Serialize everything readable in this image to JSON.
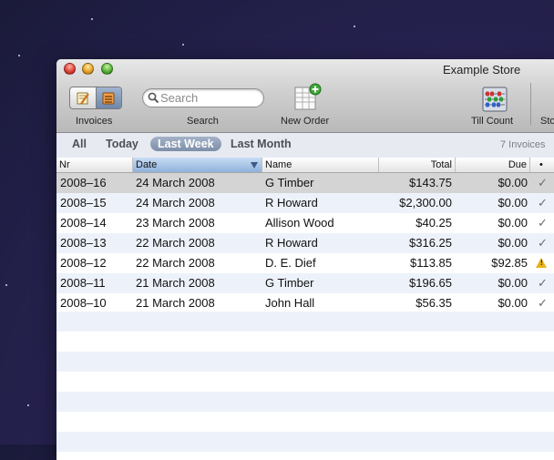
{
  "window": {
    "title": "Example Store"
  },
  "toolbar": {
    "invoices_label": "Invoices",
    "search_label": "Search",
    "search_placeholder": "Search",
    "new_order_label": "New Order",
    "till_count_label": "Till Count",
    "store_label": "Sto"
  },
  "filters": {
    "items": [
      "All",
      "Today",
      "Last Week",
      "Last Month"
    ],
    "active": "Last Week",
    "count_text": "7 Invoices"
  },
  "table": {
    "headers": {
      "nr": "Nr",
      "date": "Date",
      "name": "Name",
      "total": "Total",
      "due": "Due",
      "status": "•"
    },
    "sorted_column": "Date",
    "rows": [
      {
        "nr": "2008–16",
        "date": "24 March 2008",
        "name": "G Timber",
        "total": "$143.75",
        "due": "$0.00",
        "status": "paid",
        "status_glyph": "✓"
      },
      {
        "nr": "2008–15",
        "date": "24 March 2008",
        "name": "R Howard",
        "total": "$2,300.00",
        "due": "$0.00",
        "status": "paid",
        "status_glyph": "✓"
      },
      {
        "nr": "2008–14",
        "date": "23 March 2008",
        "name": "Allison Wood",
        "total": "$40.25",
        "due": "$0.00",
        "status": "paid",
        "status_glyph": "✓"
      },
      {
        "nr": "2008–13",
        "date": "22 March 2008",
        "name": "R Howard",
        "total": "$316.25",
        "due": "$0.00",
        "status": "paid",
        "status_glyph": "✓"
      },
      {
        "nr": "2008–12",
        "date": "22 March 2008",
        "name": "D. E. Dief",
        "total": "$113.85",
        "due": "$92.85",
        "status": "warning",
        "status_glyph": "!"
      },
      {
        "nr": "2008–11",
        "date": "21 March 2008",
        "name": "G Timber",
        "total": "$196.65",
        "due": "$0.00",
        "status": "paid",
        "status_glyph": "✓"
      },
      {
        "nr": "2008–10",
        "date": "21 March 2008",
        "name": "John Hall",
        "total": "$56.35",
        "due": "$0.00",
        "status": "paid",
        "status_glyph": "✓"
      }
    ]
  },
  "icons": {
    "close": "close-button-icon",
    "minimize": "minimize-button-icon",
    "zoom": "zoom-button-icon",
    "invoice_edit": "pencil-note-icon",
    "invoice_list": "invoice-list-icon",
    "search": "magnifier-icon",
    "new_order": "new-order-icon",
    "till_count": "abacus-icon",
    "paid": "check-icon",
    "warning": "warning-icon"
  },
  "colors": {
    "selected_row": "#d4d4d4",
    "alt_row": "#edf2fa",
    "sorted_header": "#8fb2dc",
    "active_filter": "#7d8ea8",
    "warning": "#e7b318"
  }
}
